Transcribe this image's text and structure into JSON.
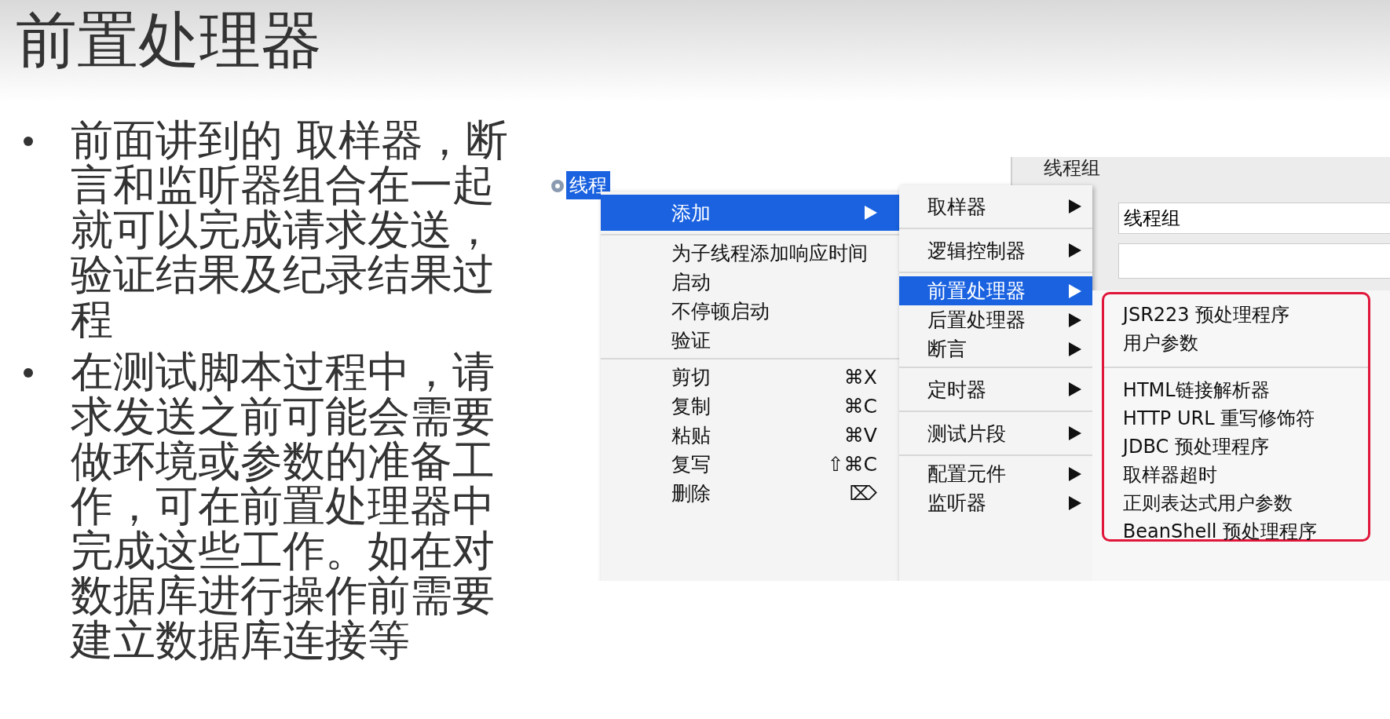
{
  "slide": {
    "title": "前置处理器",
    "bullets": [
      "前面讲到的 取样器，断言和监听器组合在一起就可以完成请求发送，验证结果及纪录结果过程",
      "在测试脚本过程中，请求发送之前可能会需要做环境或参数的准备工作，可在前置处理器中完成这些工作。如在对数据库进行操作前需要建立数据库连接等"
    ]
  },
  "screenshot": {
    "tree_node": {
      "label": "线程",
      "selected": true
    },
    "panel": {
      "header": "线程组",
      "name_field": "线程组"
    },
    "main_menu": [
      [
        {
          "label": "添加",
          "submenu": true,
          "selected": true
        }
      ],
      [
        {
          "label": "为子线程添加响应时间",
          "selected": false
        },
        {
          "label": "启动",
          "selected": false
        },
        {
          "label": "不停顿启动",
          "selected": false
        },
        {
          "label": "验证",
          "selected": false
        }
      ],
      [
        {
          "label": "剪切",
          "shortcut": "⌘X",
          "selected": false
        },
        {
          "label": "复制",
          "shortcut": "⌘C",
          "selected": false
        },
        {
          "label": "粘贴",
          "shortcut": "⌘V",
          "selected": false
        },
        {
          "label": "复写",
          "shortcut": "⇧⌘C",
          "selected": false
        },
        {
          "label": "删除",
          "shortcut": "⌦",
          "selected": false
        }
      ]
    ],
    "add_menu": [
      [
        {
          "label": "取样器",
          "submenu": true,
          "selected": false
        }
      ],
      [
        {
          "label": "逻辑控制器",
          "submenu": true,
          "selected": false
        }
      ],
      [
        {
          "label": "前置处理器",
          "submenu": true,
          "selected": true
        },
        {
          "label": "后置处理器",
          "submenu": true,
          "selected": false
        },
        {
          "label": "断言",
          "submenu": true,
          "selected": false
        }
      ],
      [
        {
          "label": "定时器",
          "submenu": true,
          "selected": false
        }
      ],
      [
        {
          "label": "测试片段",
          "submenu": true,
          "selected": false
        }
      ],
      [
        {
          "label": "配置元件",
          "submenu": true,
          "selected": false
        },
        {
          "label": "监听器",
          "submenu": true,
          "selected": false
        }
      ]
    ],
    "preprocessor_menu": {
      "highlighted": true,
      "groups": [
        [
          {
            "label": "JSR223 预处理程序"
          },
          {
            "label": "用户参数"
          }
        ],
        [
          {
            "label": "HTML链接解析器"
          },
          {
            "label": "HTTP URL 重写修饰符"
          },
          {
            "label": "JDBC 预处理程序"
          },
          {
            "label": "取样器超时"
          },
          {
            "label": "正则表达式用户参数"
          },
          {
            "label": "BeanShell 预处理程序"
          }
        ]
      ]
    }
  }
}
